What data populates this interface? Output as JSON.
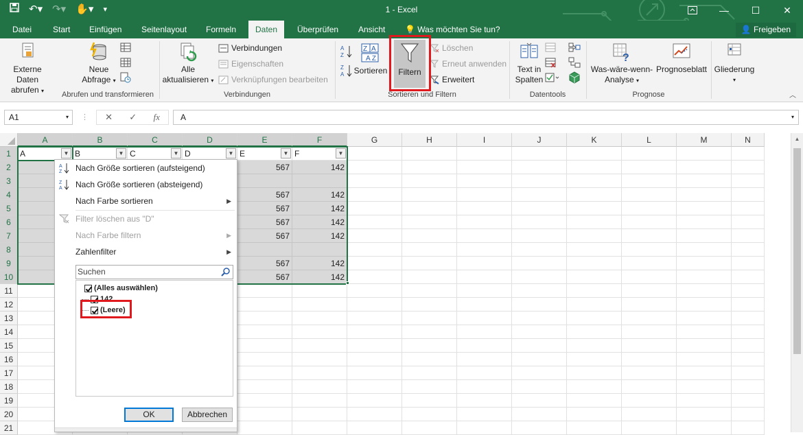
{
  "titlebar": {
    "title": "1 - Excel",
    "window_controls": [
      "restore-icon",
      "minimize-icon",
      "maximize-icon",
      "close-icon"
    ]
  },
  "tabs": {
    "items": [
      "Datei",
      "Start",
      "Einfügen",
      "Seitenlayout",
      "Formeln",
      "Daten",
      "Überprüfen",
      "Ansicht"
    ],
    "active": "Daten",
    "tell_me": "Was möchten Sie tun?",
    "share": "Freigeben"
  },
  "ribbon": {
    "external_data": "Externe Daten",
    "external_data_2": "abrufen",
    "new_query": "Neue",
    "new_query_2": "Abfrage",
    "refresh_all": "Alle",
    "refresh_all_2": "aktualisieren",
    "connections": "Verbindungen",
    "properties": "Eigenschaften",
    "edit_links": "Verknüpfungen bearbeiten",
    "sort": "Sortieren",
    "filter": "Filtern",
    "clear": "Löschen",
    "reapply": "Erneut anwenden",
    "advanced": "Erweitert",
    "text_to_columns": "Text in",
    "text_to_columns_2": "Spalten",
    "what_if": "Was-wäre-wenn-",
    "what_if_2": "Analyse",
    "forecast_sheet": "Prognoseblatt",
    "outline": "Gliederung",
    "groups": {
      "get_transform": "Abrufen und transformieren",
      "connections": "Verbindungen",
      "sort_filter": "Sortieren und Filtern",
      "data_tools": "Datentools",
      "forecast": "Prognose"
    }
  },
  "formula_bar": {
    "name_box": "A1",
    "cancel": "✕",
    "enter": "✓",
    "fx": "fx",
    "content": "A"
  },
  "grid": {
    "columns": [
      "A",
      "B",
      "C",
      "D",
      "E",
      "F",
      "G",
      "H",
      "I",
      "J",
      "K",
      "L",
      "M",
      "N"
    ],
    "rows": [
      "1",
      "2",
      "3",
      "4",
      "5",
      "6",
      "7",
      "8",
      "9",
      "10",
      "11",
      "12",
      "13",
      "14",
      "15",
      "16",
      "17",
      "18",
      "19",
      "20",
      "21"
    ],
    "header_row": [
      "A",
      "B",
      "C",
      "D",
      "E",
      "F"
    ],
    "data": {
      "E": [
        "567",
        "",
        "567",
        "567",
        "567",
        "567",
        "",
        "567",
        "567"
      ],
      "F": [
        "142",
        "",
        "142",
        "142",
        "142",
        "142",
        "",
        "142",
        "142"
      ]
    }
  },
  "filter_menu": {
    "sort_asc": "Nach Größe sortieren (aufsteigend)",
    "sort_desc": "Nach Größe sortieren (absteigend)",
    "sort_by_color": "Nach Farbe sortieren",
    "clear_filter": "Filter löschen aus \"D\"",
    "filter_by_color": "Nach Farbe filtern",
    "number_filters": "Zahlenfilter",
    "search_placeholder": "Suchen",
    "items": [
      "(Alles auswählen)",
      "142",
      "(Leere)"
    ],
    "ok": "OK",
    "cancel": "Abbrechen"
  },
  "colors": {
    "excel_green": "#217346",
    "highlight_red": "#e0191f",
    "filtered_shade": "#d9d9d9"
  }
}
